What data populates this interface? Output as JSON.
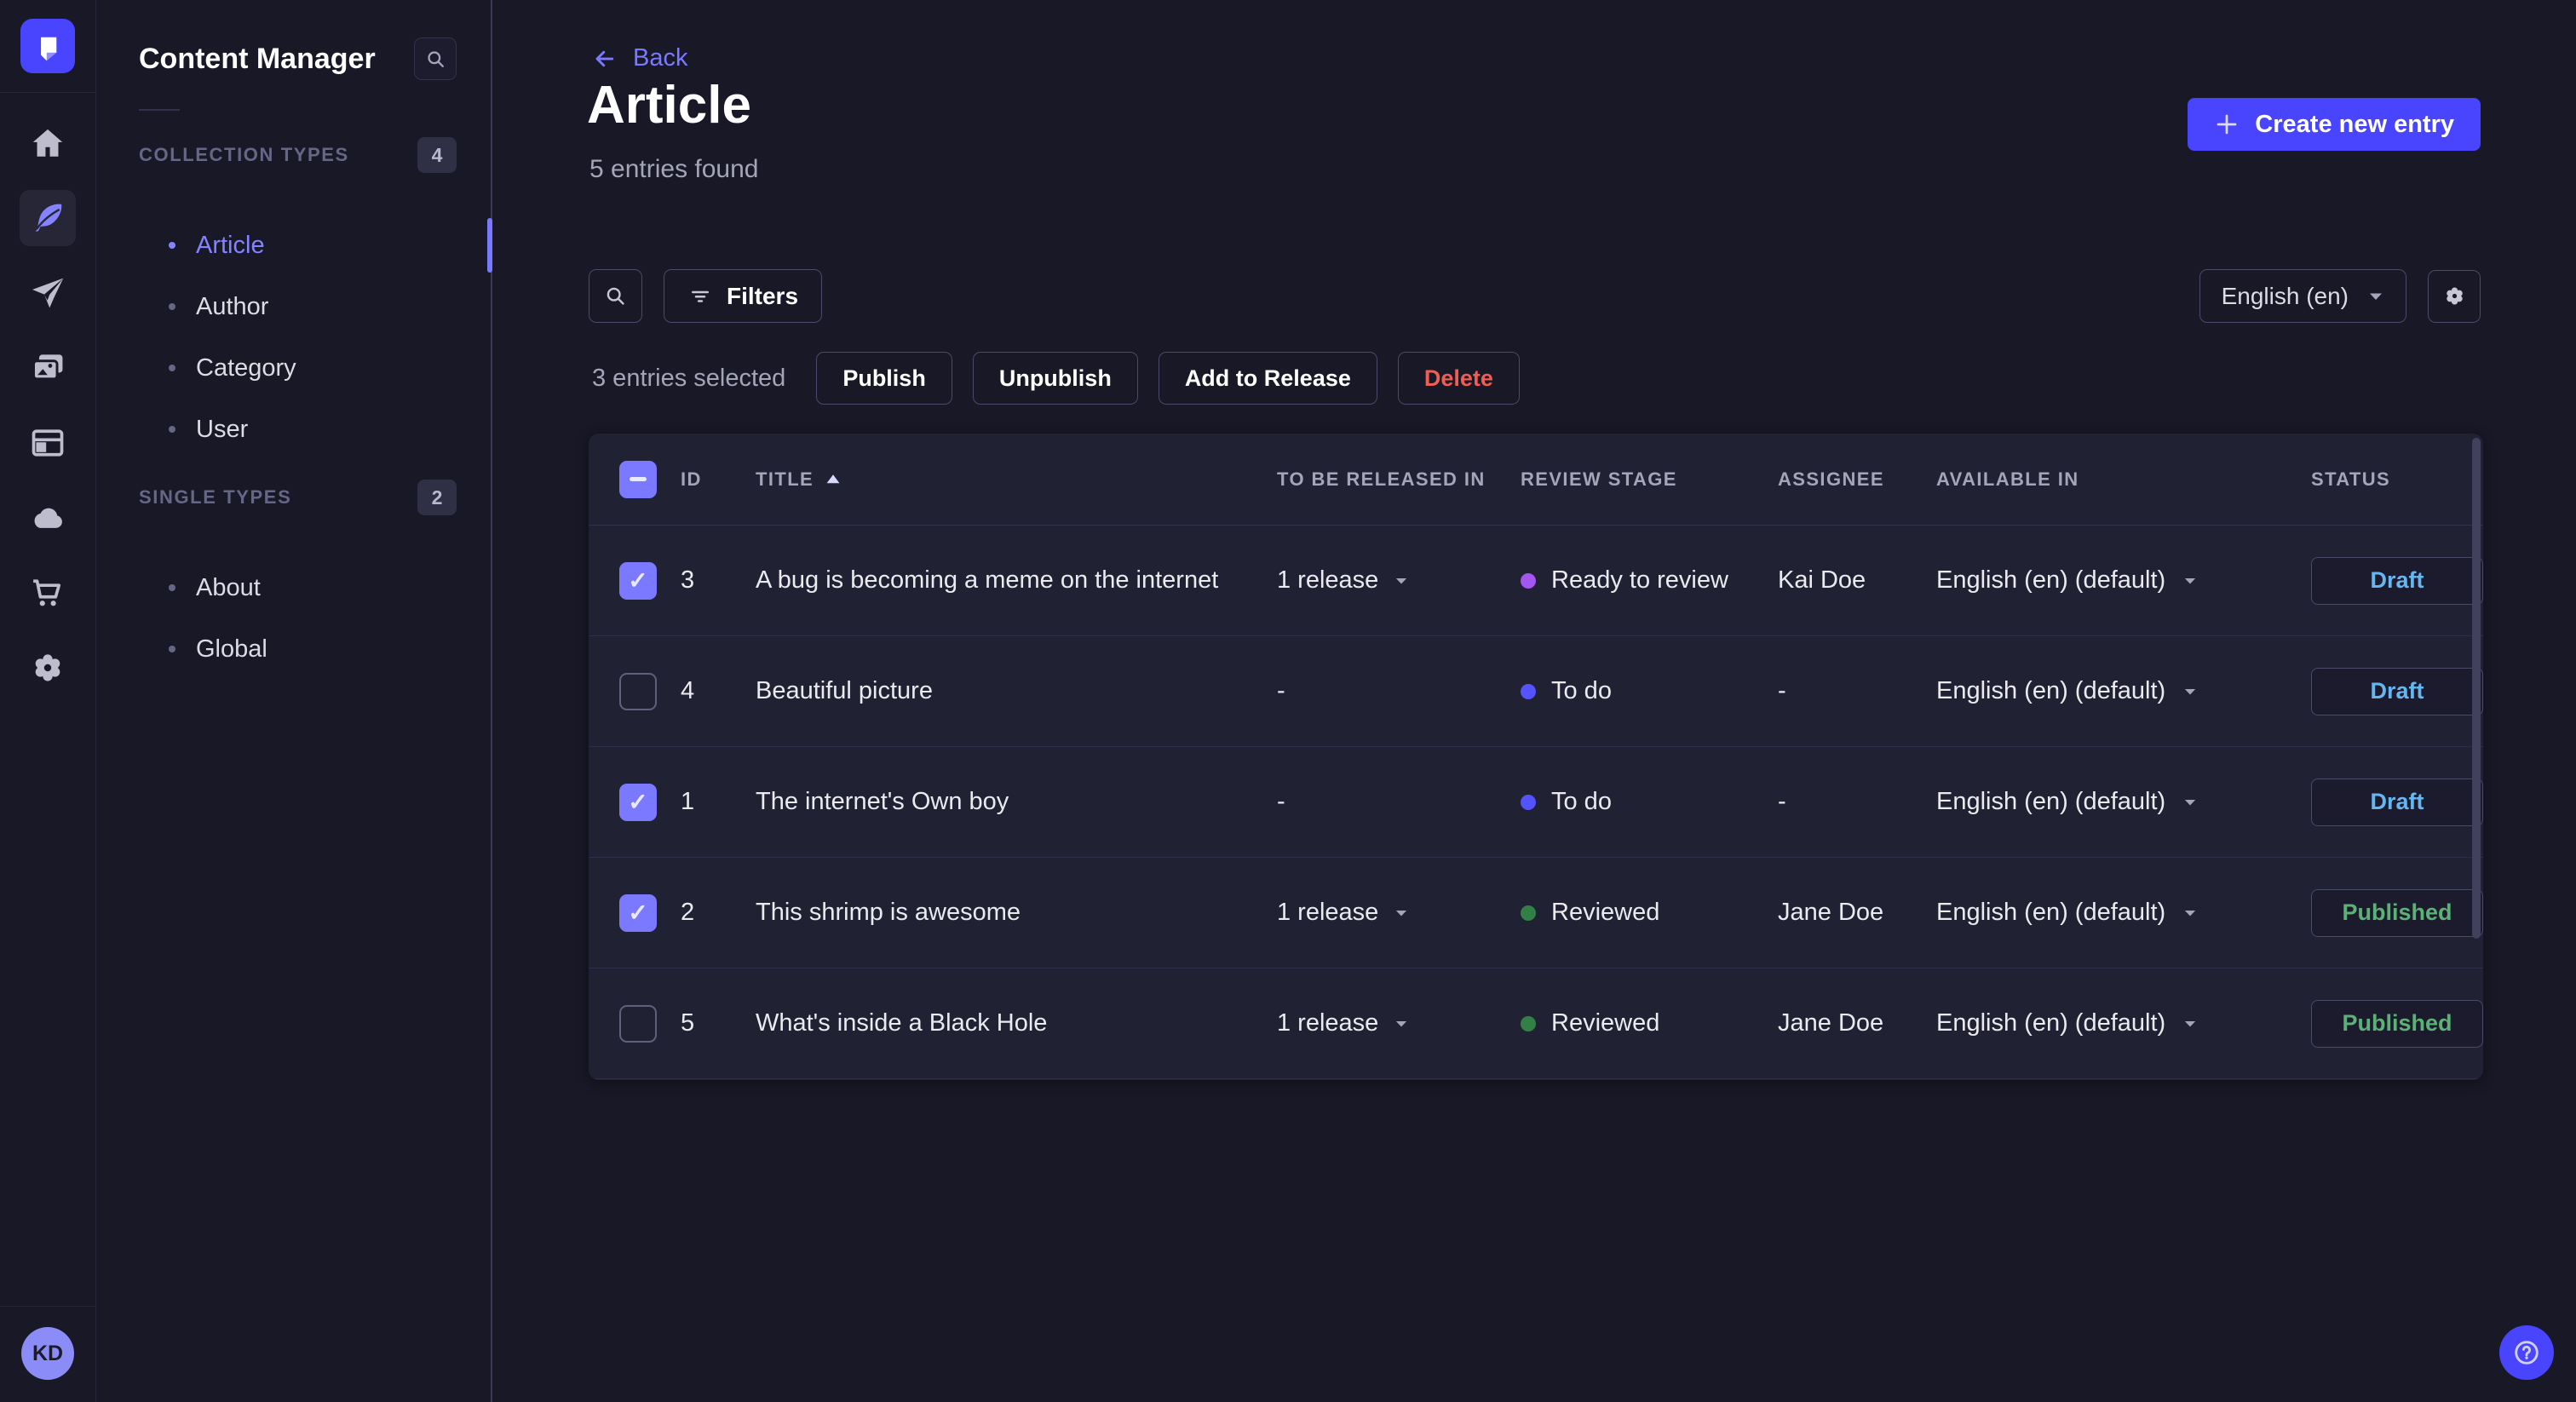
{
  "colors": {
    "primary": "#4945ff",
    "accent": "#7b79ff",
    "draft_text": "#66b7f1",
    "published_text": "#5cb176",
    "delete_text": "#ee5e52",
    "stage_ready_to_review": "#a356f0",
    "stage_to_do": "#5552ff",
    "stage_reviewed": "#328048"
  },
  "rail": {
    "icons": [
      "strapi-logo",
      "home",
      "content-manager",
      "releases",
      "media-library",
      "content-type-builder",
      "deploy",
      "marketplace",
      "settings"
    ],
    "avatar_initials": "KD"
  },
  "sidebar": {
    "title": "Content Manager",
    "sections": [
      {
        "label": "COLLECTION TYPES",
        "count": "4",
        "items": [
          {
            "label": "Article",
            "active": true
          },
          {
            "label": "Author",
            "active": false
          },
          {
            "label": "Category",
            "active": false
          },
          {
            "label": "User",
            "active": false
          }
        ]
      },
      {
        "label": "SINGLE TYPES",
        "count": "2",
        "items": [
          {
            "label": "About",
            "active": false
          },
          {
            "label": "Global",
            "active": false
          }
        ]
      }
    ]
  },
  "header": {
    "back_label": "Back",
    "title": "Article",
    "subtitle": "5 entries found",
    "create_label": "Create new entry"
  },
  "toolbar": {
    "filters_label": "Filters",
    "locale": "English (en)"
  },
  "selection": {
    "label": "3 entries selected",
    "actions": [
      {
        "label": "Publish",
        "variant": "default"
      },
      {
        "label": "Unpublish",
        "variant": "default"
      },
      {
        "label": "Add to Release",
        "variant": "default"
      },
      {
        "label": "Delete",
        "variant": "danger"
      }
    ]
  },
  "table": {
    "header_checkbox": "mixed",
    "sort_column": "TITLE",
    "columns": [
      "ID",
      "TITLE",
      "TO BE RELEASED IN",
      "REVIEW STAGE",
      "ASSIGNEE",
      "AVAILABLE IN",
      "STATUS"
    ],
    "rows": [
      {
        "checked": true,
        "id": "3",
        "title": "A bug is becoming a meme on the internet",
        "release": "1 release",
        "release_caret": true,
        "stage": "Ready to review",
        "stage_color": "#a356f0",
        "assignee": "Kai Doe",
        "locale": "English (en) (default)",
        "status": "Draft",
        "status_color": "#66b7f1"
      },
      {
        "checked": false,
        "id": "4",
        "title": "Beautiful picture",
        "release": "-",
        "release_caret": false,
        "stage": "To do",
        "stage_color": "#5552ff",
        "assignee": "-",
        "locale": "English (en) (default)",
        "status": "Draft",
        "status_color": "#66b7f1"
      },
      {
        "checked": true,
        "id": "1",
        "title": "The internet's Own boy",
        "release": "-",
        "release_caret": false,
        "stage": "To do",
        "stage_color": "#5552ff",
        "assignee": "-",
        "locale": "English (en) (default)",
        "status": "Draft",
        "status_color": "#66b7f1"
      },
      {
        "checked": true,
        "id": "2",
        "title": "This shrimp is awesome",
        "release": "1 release",
        "release_caret": true,
        "stage": "Reviewed",
        "stage_color": "#328048",
        "assignee": "Jane Doe",
        "locale": "English (en) (default)",
        "status": "Published",
        "status_color": "#5cb176"
      },
      {
        "checked": false,
        "id": "5",
        "title": "What's inside a Black Hole",
        "release": "1 release",
        "release_caret": true,
        "stage": "Reviewed",
        "stage_color": "#328048",
        "assignee": "Jane Doe",
        "locale": "English (en) (default)",
        "status": "Published",
        "status_color": "#5cb176"
      }
    ]
  }
}
